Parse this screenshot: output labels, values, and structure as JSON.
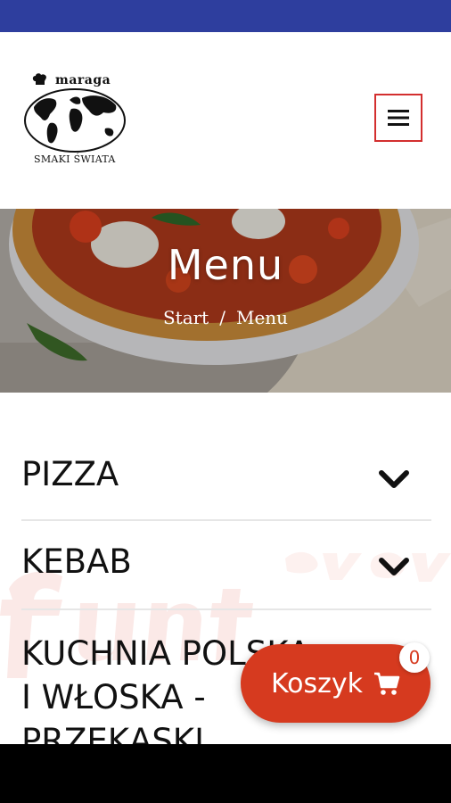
{
  "brand": {
    "name": "maraga",
    "tagline": "SMAKI ŚWIATA"
  },
  "hero": {
    "title": "Menu",
    "breadcrumb": [
      "Start",
      "Menu"
    ],
    "breadcrumb_separator": "/"
  },
  "menu": {
    "categories": [
      {
        "label": "PIZZA"
      },
      {
        "label": "KEBAB"
      },
      {
        "label": "KUCHNIA POLSKA I WŁOSKA - PRZEKĄSKI",
        "visible_lines": [
          "KUCHNIA POLSKA",
          "I WŁOSKA -",
          "PRZEKĄSKI"
        ]
      }
    ]
  },
  "cart": {
    "label": "Koszyk",
    "count": "0"
  },
  "colors": {
    "status_bar": "#2e3e9e",
    "accent_red": "#d63a1f",
    "toggle_border": "#d32f2f"
  },
  "icons": {
    "menu_toggle": "hamburger-icon",
    "category_expand": "chevron-down-icon",
    "cart": "cart-icon"
  }
}
